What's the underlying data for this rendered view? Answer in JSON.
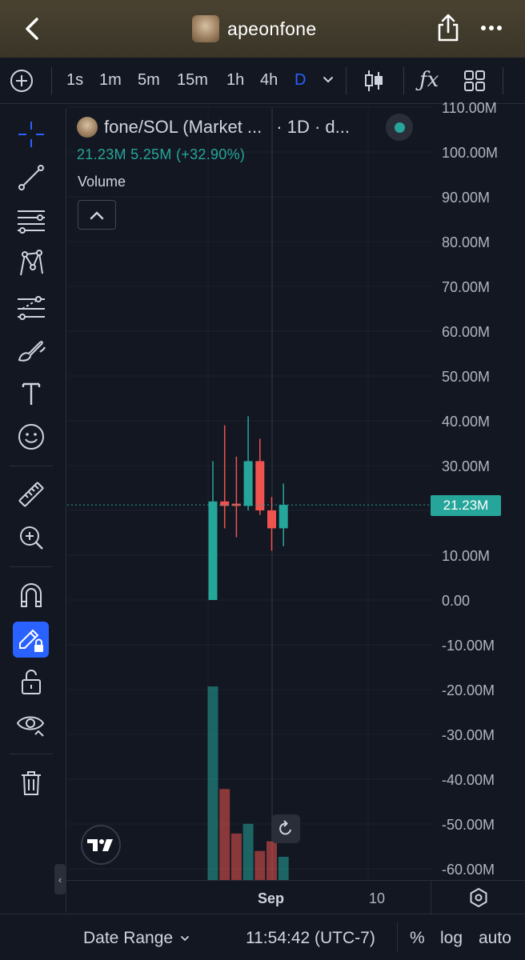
{
  "header": {
    "title": "apeonfone",
    "back_icon": "chevron-left-icon",
    "share_icon": "share-icon",
    "more_icon": "more-horizontal-icon"
  },
  "toolbar": {
    "intervals": [
      "1s",
      "1m",
      "5m",
      "15m",
      "1h",
      "4h",
      "D"
    ],
    "active_interval": "D",
    "fx_label": "ƒx"
  },
  "legend": {
    "symbol": "fone/SOL (Market ...",
    "suffix": "· 1D · d...",
    "values": "21.23M  5.25M (+32.90%)",
    "volume_label": "Volume"
  },
  "price_tag": "21.23M",
  "colors": {
    "up": "#26a69a",
    "down": "#ef5350",
    "accent": "#2962ff",
    "background": "#131722"
  },
  "chart_data": {
    "type": "candlestick",
    "y_axis_ticks": [
      "110.00M",
      "100.00M",
      "90.00M",
      "80.00M",
      "70.00M",
      "60.00M",
      "50.00M",
      "40.00M",
      "30.00M",
      "20.00M",
      "10.00M",
      "0.00",
      "-10.00M",
      "-20.00M",
      "-30.00M",
      "-40.00M",
      "-50.00M",
      "-60.00M"
    ],
    "ylim": [
      -62,
      112
    ],
    "x_axis_ticks": [
      "Sep",
      "10"
    ],
    "last_price": 21.23,
    "candles": [
      {
        "open": 0,
        "high": 31,
        "low": 0,
        "close": 22,
        "color": "up"
      },
      {
        "open": 22,
        "high": 39,
        "low": 16,
        "close": 21,
        "color": "down"
      },
      {
        "open": 21.5,
        "high": 32,
        "low": 14,
        "close": 21,
        "color": "down"
      },
      {
        "open": 21,
        "high": 41,
        "low": 20,
        "close": 31,
        "color": "up"
      },
      {
        "open": 31,
        "high": 36,
        "low": 19,
        "close": 20,
        "color": "down"
      },
      {
        "open": 20,
        "high": 23,
        "low": 11,
        "close": 16,
        "color": "down"
      },
      {
        "open": 16,
        "high": 26,
        "low": 12,
        "close": 21.23,
        "color": "up"
      }
    ],
    "volume": [
      {
        "value": 1.0,
        "color": "up"
      },
      {
        "value": 0.47,
        "color": "down"
      },
      {
        "value": 0.24,
        "color": "down"
      },
      {
        "value": 0.29,
        "color": "up"
      },
      {
        "value": 0.15,
        "color": "down"
      },
      {
        "value": 0.2,
        "color": "down"
      },
      {
        "value": 0.12,
        "color": "up"
      }
    ]
  },
  "bottom_bar": {
    "date_range": "Date Range",
    "time": "11:54:42 (UTC-7)",
    "percent": "%",
    "log": "log",
    "auto": "auto"
  },
  "sidebar_tools": [
    "crosshair-icon",
    "trend-line-icon",
    "fib-lines-icon",
    "pattern-icon",
    "forecast-icon",
    "brush-icon",
    "text-icon",
    "emoji-icon",
    "ruler-icon",
    "zoom-in-icon",
    "magnet-icon",
    "lock-drawing-icon",
    "unlock-icon",
    "eye-icon",
    "trash-icon"
  ]
}
